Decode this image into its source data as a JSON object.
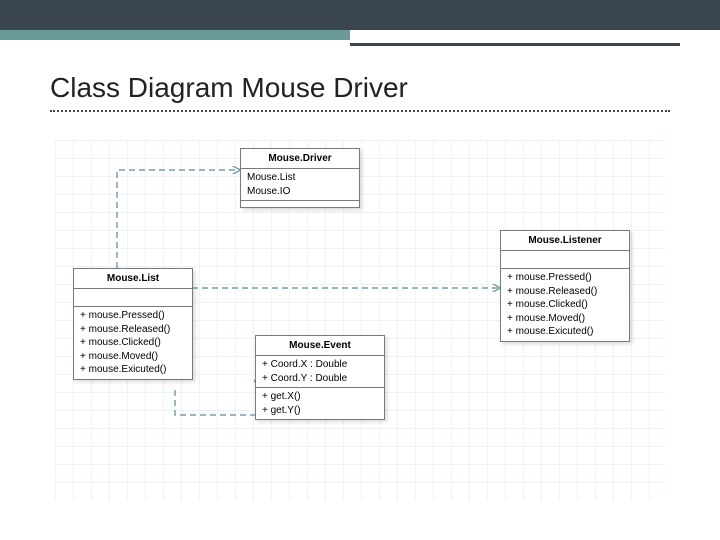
{
  "header": {
    "title": "Class Diagram Mouse Driver"
  },
  "classes": {
    "mouseDriver": {
      "name": "Mouse.Driver",
      "attributes": [
        "Mouse.List",
        "Mouse.IO"
      ],
      "methods": []
    },
    "mouseList": {
      "name": "Mouse.List",
      "attributes": [],
      "methods": [
        "+ mouse.Pressed()",
        "+ mouse.Released()",
        "+ mouse.Clicked()",
        "+ mouse.Moved()",
        "+ mouse.Exicuted()"
      ]
    },
    "mouseEvent": {
      "name": "Mouse.Event",
      "attributes": [
        "+ Coord.X : Double",
        "+ Coord.Y : Double"
      ],
      "methods": [
        "+ get.X()",
        "+ get.Y()"
      ]
    },
    "mouseListener": {
      "name": "Mouse.Listener",
      "attributes": [],
      "methods": [
        "+ mouse.Pressed()",
        "+ mouse.Released()",
        "+ mouse.Clicked()",
        "+ mouse.Moved()",
        "+ mouse.Exicuted()"
      ]
    }
  }
}
